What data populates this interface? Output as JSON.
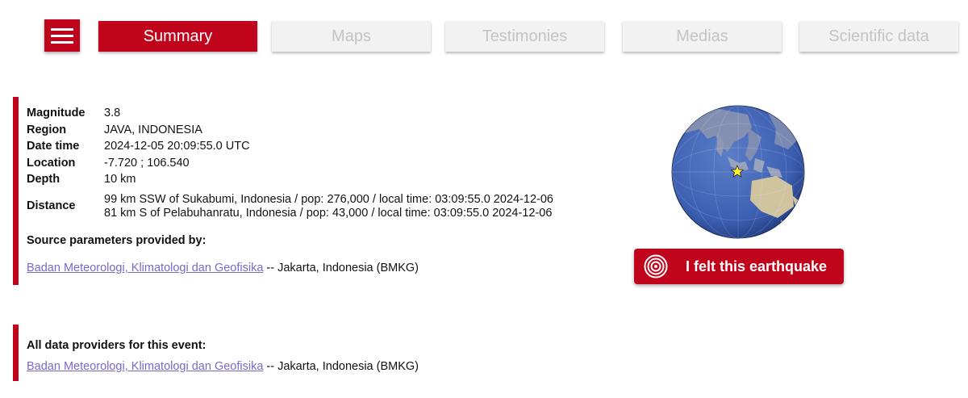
{
  "nav": {
    "tabs": [
      {
        "label": "Summary",
        "active": true
      },
      {
        "label": "Maps",
        "active": false
      },
      {
        "label": "Testimonies",
        "active": false
      },
      {
        "label": "Medias",
        "active": false
      },
      {
        "label": "Scientific data",
        "active": false
      }
    ]
  },
  "event": {
    "magnitude_label": "Magnitude",
    "magnitude": "3.8",
    "region_label": "Region",
    "region": "JAVA, INDONESIA",
    "datetime_label": "Date time",
    "datetime": "2024-12-05 20:09:55.0 UTC",
    "location_label": "Location",
    "location": "-7.720 ; 106.540",
    "depth_label": "Depth",
    "depth": "10 km",
    "distance_label": "Distance",
    "distances": [
      "99 km SSW of Sukabumi, Indonesia / pop: 276,000 / local time: 03:09:55.0 2024-12-06",
      "81 km S of Pelabuhanratu, Indonesia / pop: 43,000 / local time: 03:09:55.0 2024-12-06"
    ]
  },
  "source": {
    "heading": "Source parameters provided by:",
    "provider_link": "Badan Meteorologi, Klimatologi dan Geofisika",
    "provider_suffix": " -- Jakarta, Indonesia (BMKG)"
  },
  "providers": {
    "heading": "All data providers for this event:",
    "provider_link": "Badan Meteorologi, Klimatologi dan Geofisika",
    "provider_suffix": " -- Jakarta, Indonesia (BMKG)"
  },
  "felt_button": {
    "label": "I felt this earthquake",
    "icon": "target-icon"
  },
  "globe": {
    "marker_icon": "star-icon",
    "colors": {
      "ocean": "#3d5fb2",
      "land": "#8a93b0",
      "marker": "#ffee33"
    }
  },
  "colors": {
    "accent": "#c0041b",
    "tab_inactive_bg": "#f2f2f2",
    "tab_inactive_text": "#c4c4c4",
    "link": "#7b68c6"
  }
}
